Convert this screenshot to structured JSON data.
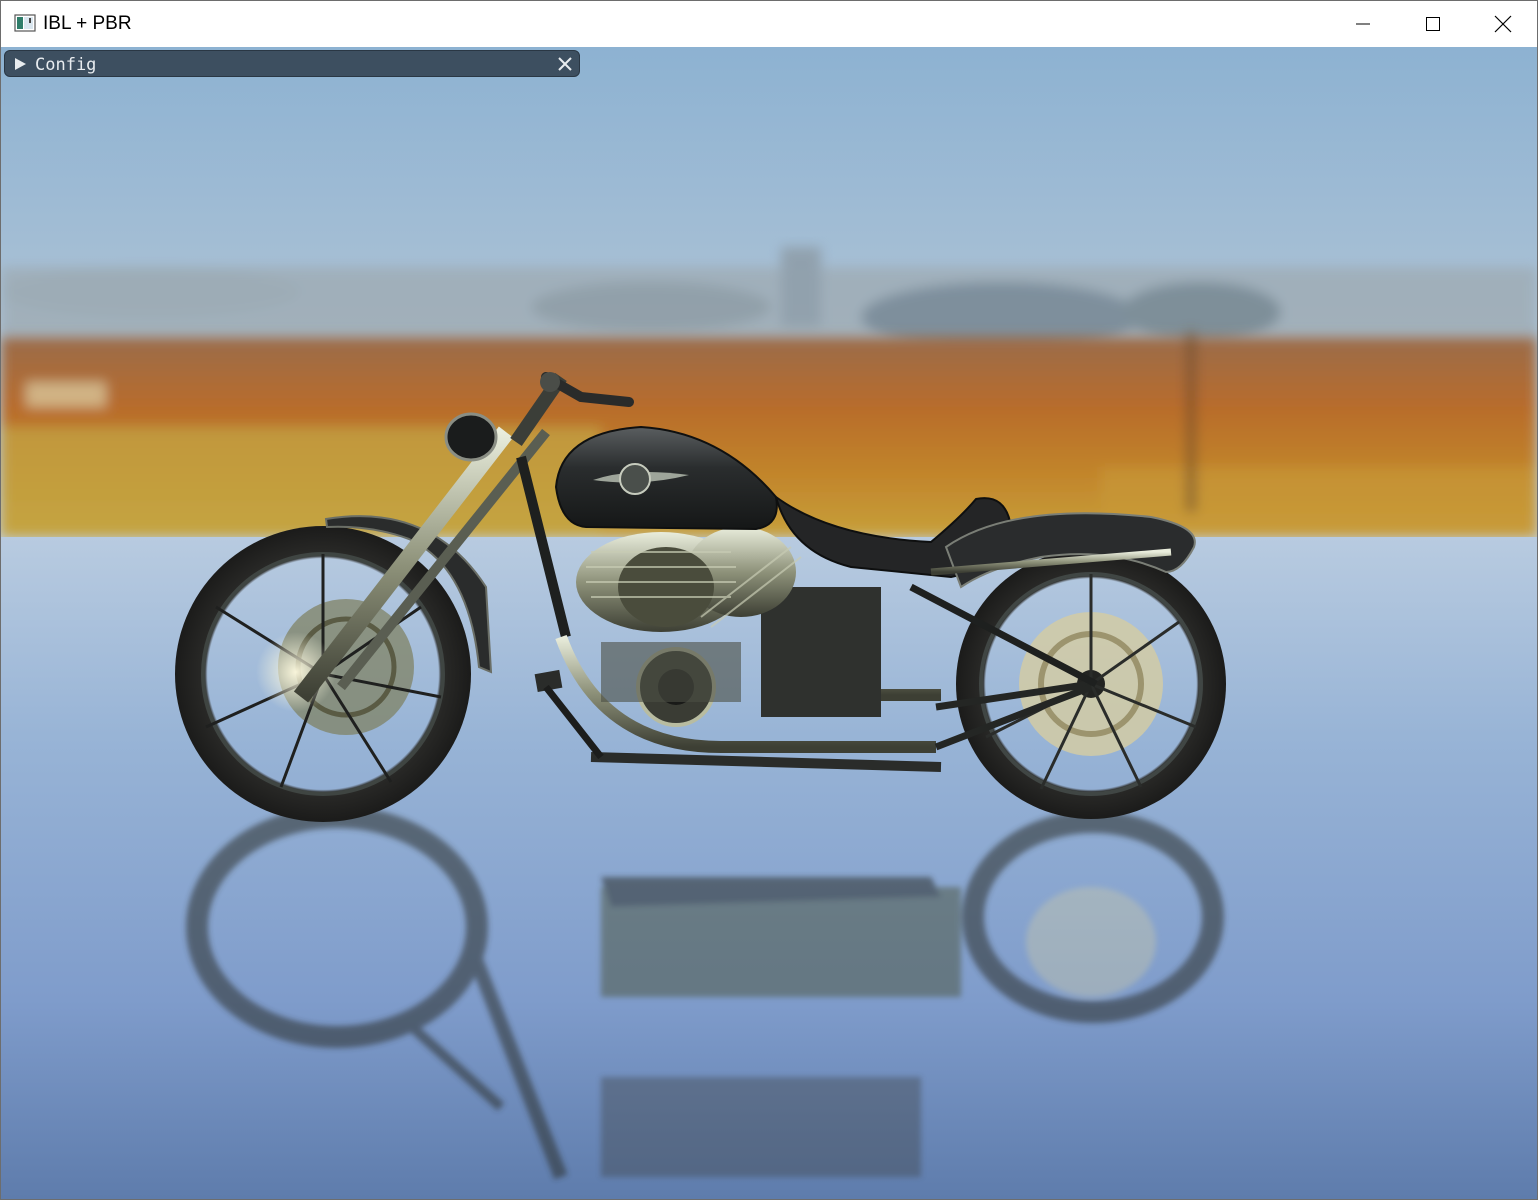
{
  "window": {
    "title": "IBL + PBR",
    "app_icon": "opengl-app-icon",
    "controls": {
      "minimize": "minimize-icon",
      "maximize": "maximize-icon",
      "close": "close-icon"
    }
  },
  "config_panel": {
    "title": "Config",
    "collapsed": true,
    "expand_icon": "triangle-right-icon",
    "close_icon": "close-x-icon"
  },
  "scene": {
    "subject": "motorcycle",
    "sky_color_top": "#8fb4d3",
    "sky_color_horizon": "#b5c7d6",
    "field_color": "#b5702e",
    "floor_color": "#9fb8d6",
    "floor_color_bottom": "#5f7fae"
  }
}
